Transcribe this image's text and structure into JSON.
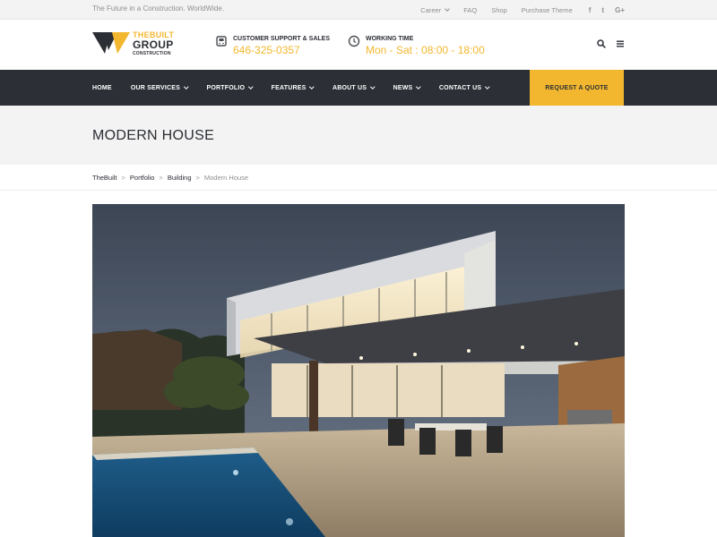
{
  "topbar": {
    "tagline": "The Future in a Construction. WorldWide.",
    "links": [
      {
        "label": "Career",
        "has_dropdown": true
      },
      {
        "label": "FAQ"
      },
      {
        "label": "Shop"
      },
      {
        "label": "Purchase Theme"
      }
    ],
    "social": [
      {
        "icon": "facebook-icon",
        "glyph": "f"
      },
      {
        "icon": "twitter-icon",
        "glyph": "t"
      },
      {
        "icon": "google-plus-icon",
        "glyph": "G+"
      }
    ]
  },
  "logo": {
    "line1": "THEBUILT",
    "line2": "GROUP",
    "line3": "CONSTRUCTION"
  },
  "support": {
    "label": "CUSTOMER SUPPORT & SALES",
    "value": "646-325-0357",
    "icon": "phone-icon"
  },
  "hours": {
    "label": "WORKING TIME",
    "value": "Mon - Sat : 08:00 - 18:00",
    "icon": "clock-icon"
  },
  "header_icons": [
    "search-icon",
    "menu-icon"
  ],
  "nav": {
    "items": [
      {
        "label": "HOME",
        "has_dropdown": false
      },
      {
        "label": "OUR SERVICES",
        "has_dropdown": true
      },
      {
        "label": "PORTFOLIO",
        "has_dropdown": true
      },
      {
        "label": "FEATURES",
        "has_dropdown": true
      },
      {
        "label": "ABOUT US",
        "has_dropdown": true
      },
      {
        "label": "NEWS",
        "has_dropdown": true
      },
      {
        "label": "CONTACT US",
        "has_dropdown": true
      }
    ],
    "cta": "REQUEST A QUOTE"
  },
  "page": {
    "title": "MODERN HOUSE"
  },
  "breadcrumb": {
    "items": [
      "TheBuilt",
      "Portfolio",
      "Building"
    ],
    "current": "Modern House"
  },
  "colors": {
    "accent": "#f3b72f",
    "nav_bg": "#2c2f35",
    "text_dark": "#2b2e34",
    "muted": "#8f8f8f"
  }
}
